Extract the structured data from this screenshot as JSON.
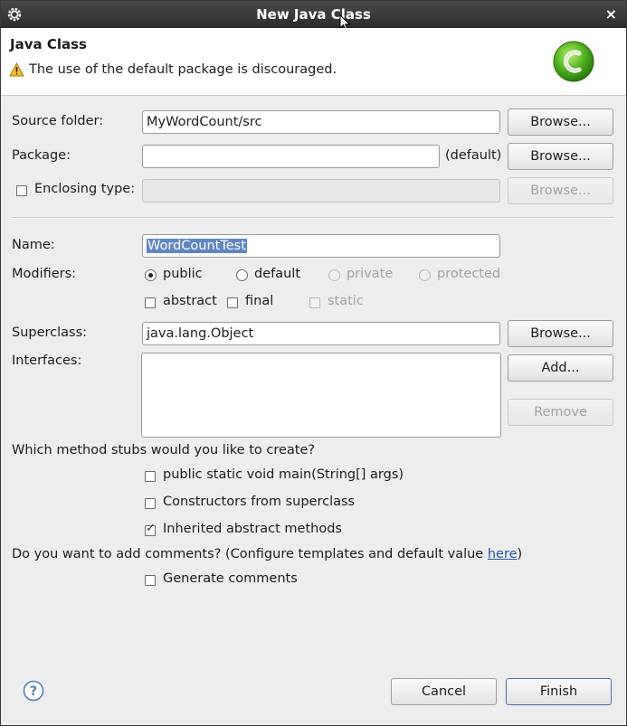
{
  "window": {
    "title": "New Java Class",
    "close_glyph": "×",
    "app_icon": "eclipse-gear-icon"
  },
  "header": {
    "title": "Java Class",
    "warning": "The use of the default package is discouraged.",
    "warning_icon": "warning-icon",
    "logo_icon": "new-class-c-logo-icon"
  },
  "source_folder": {
    "label": "Source folder:",
    "value": "MyWordCount/src",
    "browse": "Browse..."
  },
  "package": {
    "label": "Package:",
    "value": "",
    "default_label": "(default)",
    "browse": "Browse..."
  },
  "enclosing_type": {
    "label": "Enclosing type:",
    "checked": false,
    "value": "",
    "browse": "Browse..."
  },
  "name": {
    "label": "Name:",
    "value": "WordCountTest"
  },
  "modifiers": {
    "label": "Modifiers:",
    "radios": [
      {
        "label": "public",
        "selected": true,
        "enabled": true
      },
      {
        "label": "default",
        "selected": false,
        "enabled": true
      },
      {
        "label": "private",
        "selected": false,
        "enabled": false
      },
      {
        "label": "protected",
        "selected": false,
        "enabled": false
      }
    ],
    "checks": [
      {
        "label": "abstract",
        "checked": false,
        "enabled": true
      },
      {
        "label": "final",
        "checked": false,
        "enabled": true
      },
      {
        "label": "static",
        "checked": false,
        "enabled": false
      }
    ]
  },
  "superclass": {
    "label": "Superclass:",
    "value": "java.lang.Object",
    "browse": "Browse..."
  },
  "interfaces": {
    "label": "Interfaces:",
    "add": "Add...",
    "remove": "Remove"
  },
  "stubs": {
    "question": "Which method stubs would you like to create?",
    "options": [
      {
        "label": "public static void main(String[] args)",
        "checked": false
      },
      {
        "label": "Constructors from superclass",
        "checked": false
      },
      {
        "label": "Inherited abstract methods",
        "checked": true
      }
    ]
  },
  "comments": {
    "question_prefix": "Do you want to add comments? (Configure templates and default value ",
    "link": "here",
    "question_suffix": ")",
    "option": {
      "label": "Generate comments",
      "checked": false
    }
  },
  "footer": {
    "help_icon": "help-icon",
    "cancel": "Cancel",
    "finish": "Finish"
  },
  "colors": {
    "selection": "#5e86c4",
    "link": "#2450a8",
    "titlebar": "#2c2c2c",
    "logo": "#4cae1e"
  }
}
